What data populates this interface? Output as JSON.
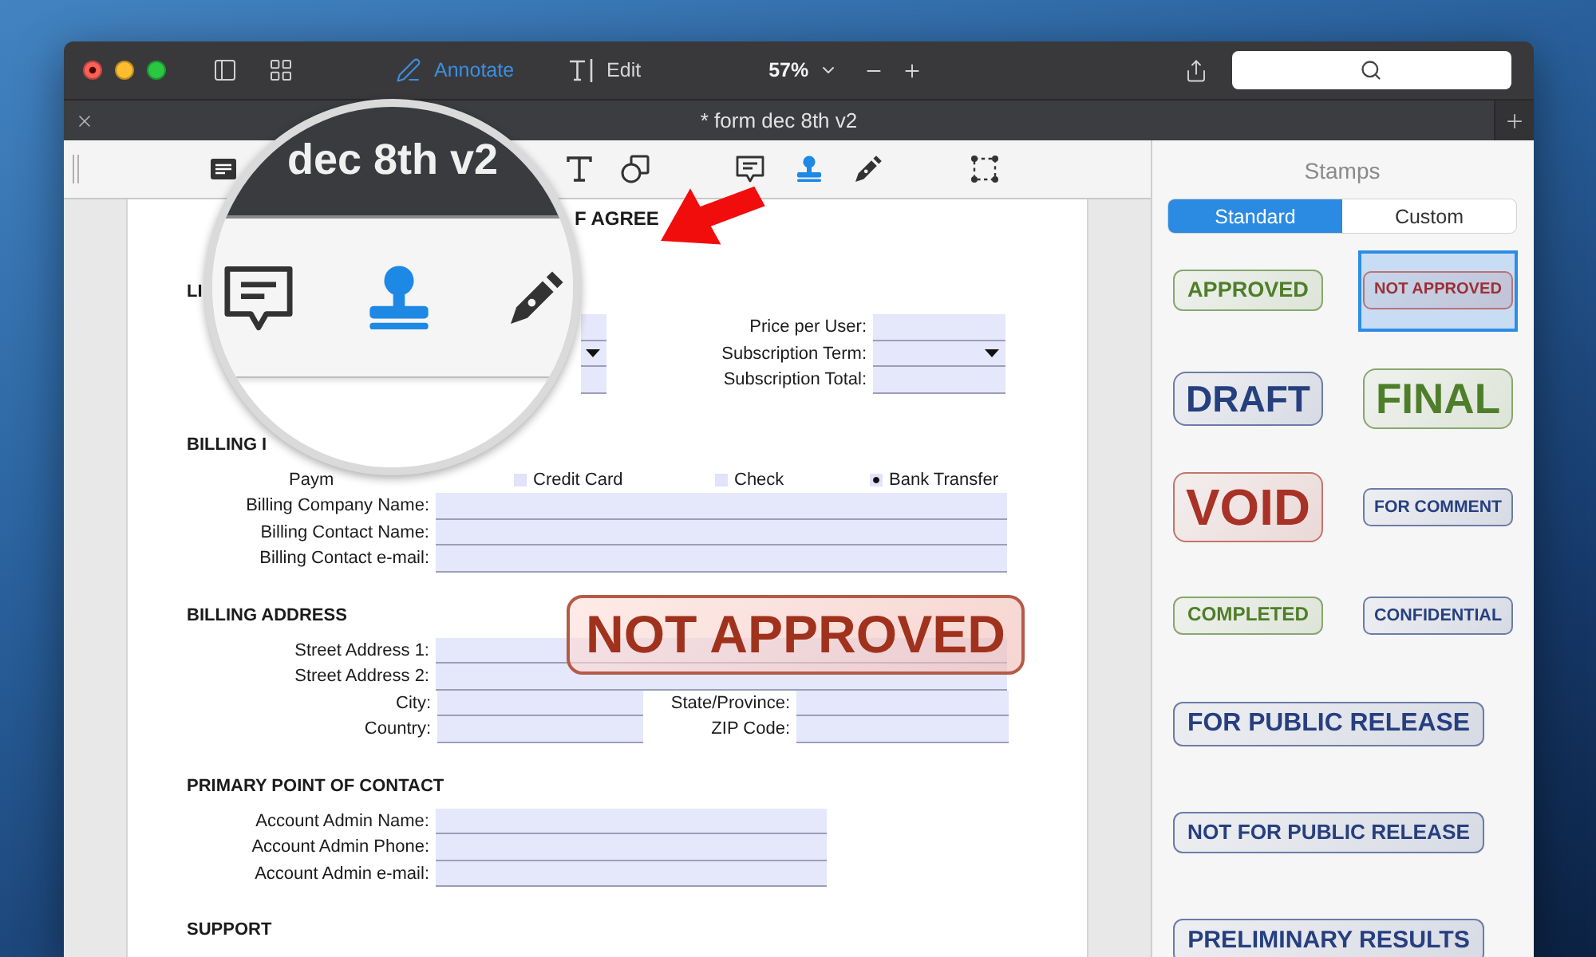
{
  "window": {
    "unsaved": true
  },
  "title_bar": {
    "modes": [
      {
        "label": "Annotate",
        "selected": true
      },
      {
        "label": "Edit",
        "selected": false
      }
    ],
    "zoom": "57%"
  },
  "tab_bar": {
    "title": "* form dec 8th v2"
  },
  "annotation_tools": [
    {
      "kind": "form",
      "selected": false
    },
    {
      "kind": "text",
      "selected": false
    },
    {
      "kind": "shape",
      "selected": false
    },
    {
      "kind": "note",
      "selected": false
    },
    {
      "kind": "stamp",
      "selected": true
    },
    {
      "kind": "pen",
      "selected": false
    },
    {
      "kind": "select",
      "selected": false
    }
  ],
  "magnifier": {
    "title": "dec 8th v2",
    "tools": [
      {
        "kind": "note",
        "selected": false
      },
      {
        "kind": "stamp",
        "selected": true
      },
      {
        "kind": "pen",
        "selected": false
      }
    ]
  },
  "document": {
    "title": "F AGREE",
    "sections": [
      {
        "heading": "LI",
        "rows": [
          {
            "kind": "pair",
            "left": {
              "dropdown": false
            },
            "label": "Price per User:",
            "dropdown": false
          },
          {
            "kind": "pair",
            "left": {
              "dropdown": true
            },
            "label": "Subscription Term:",
            "dropdown": true
          },
          {
            "kind": "pair",
            "left": {
              "dropdown": false
            },
            "label": "Subscription Total:",
            "dropdown": false
          }
        ]
      },
      {
        "heading": "BILLING I",
        "rows": [
          {
            "kind": "options",
            "label": "Paym",
            "options": [
              {
                "label": "Credit Card",
                "selected": false
              },
              {
                "label": "Check",
                "selected": false
              },
              {
                "label": "Bank Transfer",
                "selected": true
              }
            ]
          },
          {
            "kind": "full",
            "label": "Billing Company Name:"
          },
          {
            "kind": "full",
            "label": "Billing Contact Name:"
          },
          {
            "kind": "full",
            "label": "Billing Contact e-mail:"
          }
        ]
      },
      {
        "heading": "BILLING ADDRESS",
        "rows": [
          {
            "kind": "full",
            "label": "Street Address 1:"
          },
          {
            "kind": "full",
            "label": "Street Address 2:"
          },
          {
            "kind": "double",
            "label": "City:",
            "label_2": "State/Province:"
          },
          {
            "kind": "double",
            "label": "Country:",
            "label_2": "ZIP Code:"
          }
        ]
      },
      {
        "heading": "PRIMARY POINT OF CONTACT",
        "rows": [
          {
            "kind": "half",
            "label": "Account Admin Name:"
          },
          {
            "kind": "half",
            "label": "Account Admin Phone:"
          },
          {
            "kind": "half",
            "label": "Account Admin e-mail:"
          }
        ]
      },
      {
        "heading": "SUPPORT"
      }
    ],
    "stamp": {
      "text": "NOT APPROVED"
    }
  },
  "stamps_panel": {
    "title": "Stamps",
    "tabs": [
      {
        "label": "Standard",
        "selected": true
      },
      {
        "label": "Custom",
        "selected": false
      }
    ],
    "stamps": [
      {
        "text": "APPROVED",
        "kind": "label",
        "color": "#4e7e2a",
        "selected": false
      },
      {
        "text": "NOT APPROVED",
        "kind": "tag",
        "color": "#9c2f36",
        "selected": true
      },
      {
        "text": "DRAFT",
        "kind": "block",
        "color": "#263f7f",
        "selected": false
      },
      {
        "text": "FINAL",
        "kind": "block",
        "color": "#4e7e2a",
        "selected": false
      },
      {
        "text": "VOID",
        "kind": "block",
        "color": "#a83226",
        "selected": false
      },
      {
        "text": "FOR COMMENT",
        "kind": "tag",
        "color": "#263f7f",
        "selected": false
      },
      {
        "text": "COMPLETED",
        "kind": "label",
        "color": "#4e7e2a",
        "selected": false
      },
      {
        "text": "CONFIDENTIAL",
        "kind": "tag",
        "color": "#263f7f",
        "selected": false
      },
      {
        "text": "FOR PUBLIC RELEASE",
        "kind": "banner",
        "color": "#263f7f",
        "selected": false
      },
      {
        "text": "NOT FOR PUBLIC RELEASE",
        "kind": "banner",
        "color": "#263f7f",
        "selected": false
      },
      {
        "text": "PRELIMINARY RESULTS",
        "kind": "banner",
        "color": "#263f7f",
        "selected": false
      }
    ]
  }
}
